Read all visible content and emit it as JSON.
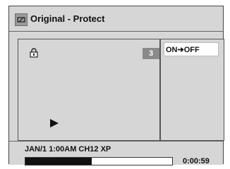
{
  "header": {
    "title": "Original - Protect",
    "icon": "protect-icon"
  },
  "preview": {
    "lock_icon": "lock-icon",
    "title_number": "3",
    "play_icon": "play-icon"
  },
  "options": {
    "selected": "ON➔OFF"
  },
  "status": {
    "info": "JAN/1 1:00AM CH12 XP",
    "progress": 0.45,
    "time": "0:00:59"
  }
}
